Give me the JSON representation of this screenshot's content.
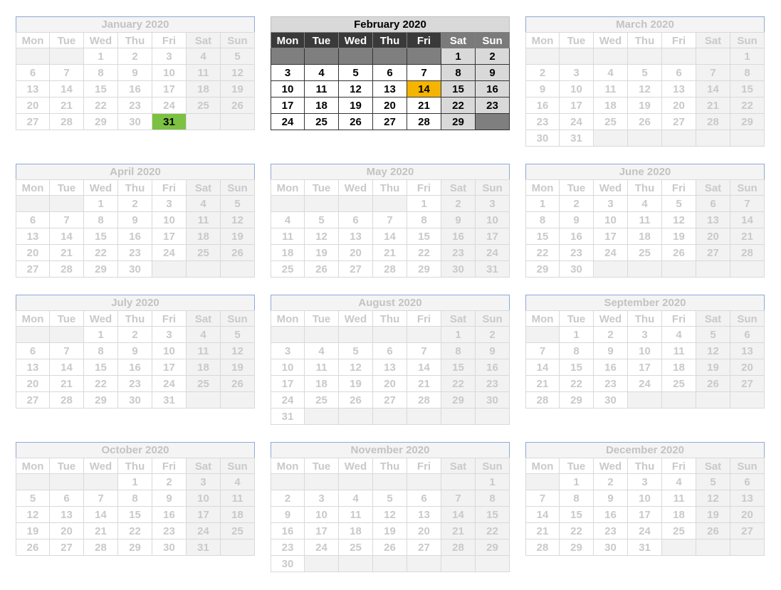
{
  "weekdays": [
    "Mon",
    "Tue",
    "Wed",
    "Thu",
    "Fri",
    "Sat",
    "Sun"
  ],
  "months": [
    {
      "title": "January 2020",
      "offset": 2,
      "days": 31,
      "highlight": 31,
      "highlight_color": "#7cc142"
    },
    {
      "title": "February 2020",
      "offset": 5,
      "days": 29,
      "active": true,
      "highlight": 14,
      "highlight_color": "#f5b400"
    },
    {
      "title": "March 2020",
      "offset": 6,
      "days": 31
    },
    {
      "title": "April 2020",
      "offset": 2,
      "days": 30
    },
    {
      "title": "May 2020",
      "offset": 4,
      "days": 31
    },
    {
      "title": "June 2020",
      "offset": 0,
      "days": 30
    },
    {
      "title": "July 2020",
      "offset": 2,
      "days": 31
    },
    {
      "title": "August 2020",
      "offset": 5,
      "days": 31
    },
    {
      "title": "September 2020",
      "offset": 1,
      "days": 30
    },
    {
      "title": "October 2020",
      "offset": 3,
      "days": 31
    },
    {
      "title": "November 2020",
      "offset": 6,
      "days": 30
    },
    {
      "title": "December 2020",
      "offset": 1,
      "days": 31
    }
  ]
}
